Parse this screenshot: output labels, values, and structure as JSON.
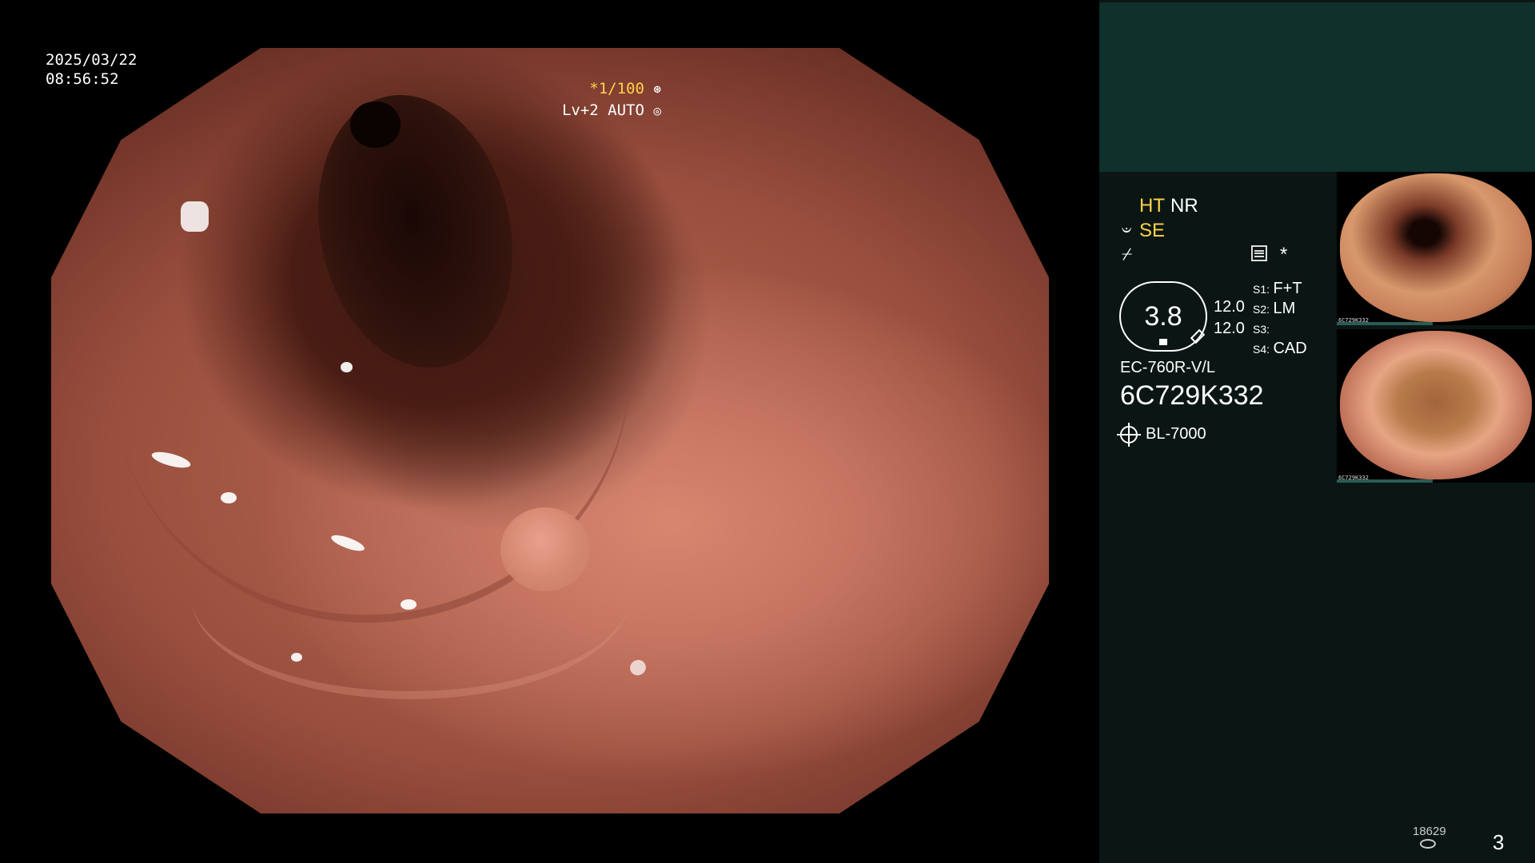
{
  "overlay": {
    "date": "2025/03/22",
    "time": "08:56:52",
    "shutter_speed": "*1/100",
    "shutter_icon": "aperture-icon",
    "exposure": "Lv+2 AUTO",
    "exposure_icon": "exposure-icon"
  },
  "panel": {
    "ht": "HT",
    "nr": "NR",
    "se_icon": "𝄑",
    "se": "SE",
    "zap_icon": "⌿",
    "star": "*",
    "zoom_value": "3.8",
    "zoom_a": "12.0",
    "zoom_b": "12.0",
    "slots": [
      {
        "key": "S1:",
        "value": "F+T"
      },
      {
        "key": "S2:",
        "value": "LM"
      },
      {
        "key": "S3:",
        "value": ""
      },
      {
        "key": "S4:",
        "value": "CAD"
      }
    ],
    "scope_model": "EC-760R-V/L",
    "scope_serial": "6C729K332",
    "light_source": "BL-7000"
  },
  "thumbnails": [
    {
      "caption": "6C729K332"
    },
    {
      "caption": "6C729K332"
    }
  ],
  "footer": {
    "counter": "18629",
    "page": "3"
  }
}
